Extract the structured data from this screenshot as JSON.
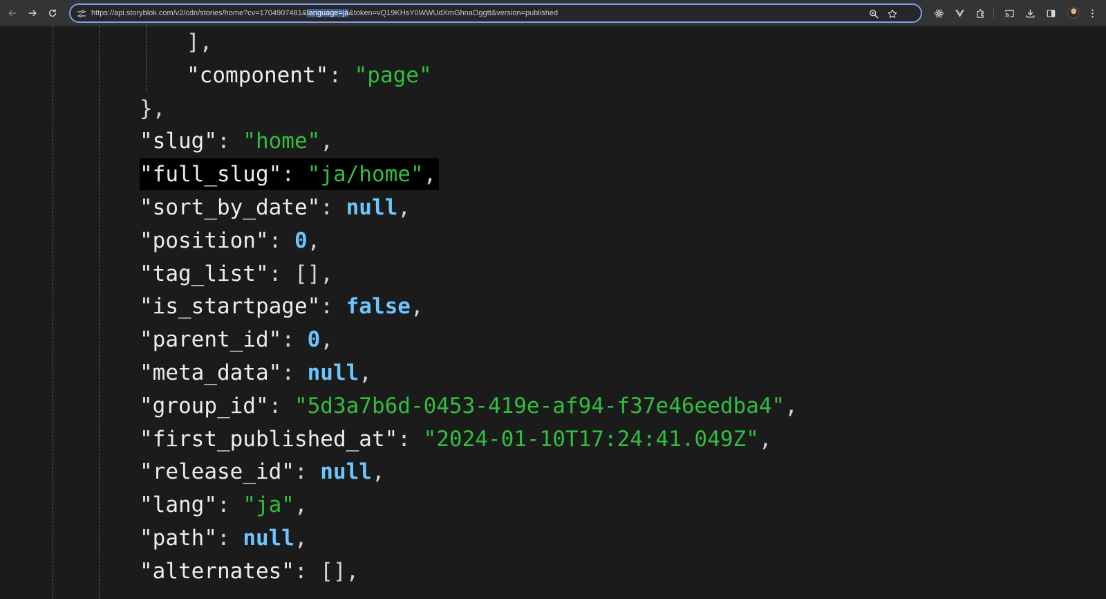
{
  "browser": {
    "url": {
      "before": "https://api.storyblok.com/v2/cdn/stories/home?cv=1704907481&",
      "selected": "language=ja",
      "after": "&token=vQ19KHsY0WWUdXmGhnaOggtt&version=published"
    },
    "toolbar_icons": [
      "back-icon",
      "forward-icon",
      "reload-icon",
      "site-settings-icon",
      "zoom-icon",
      "bookmark-star-icon",
      "react-devtools-icon",
      "vue-devtools-icon",
      "extensions-icon",
      "cast-icon",
      "downloads-icon",
      "side-panel-icon",
      "profile-avatar",
      "menu-kebab-icon"
    ]
  },
  "json_lines": [
    {
      "pre": "],",
      "key": "",
      "sep": "",
      "val": "",
      "vtype": "",
      "post": ""
    },
    {
      "pre": "",
      "key": "\"component\"",
      "sep": ": ",
      "val": "\"page\"",
      "vtype": "s",
      "post": ""
    },
    {
      "pre": "},",
      "key": "",
      "sep": "",
      "val": "",
      "vtype": "",
      "post": ""
    },
    {
      "pre": "",
      "key": "\"slug\"",
      "sep": ": ",
      "val": "\"home\"",
      "vtype": "s",
      "post": ","
    },
    {
      "pre": "",
      "key": "\"full_slug\"",
      "sep": ": ",
      "val": "\"ja/home\"",
      "vtype": "s",
      "post": ",",
      "highlighted": true
    },
    {
      "pre": "",
      "key": "\"sort_by_date\"",
      "sep": ": ",
      "val": "null",
      "vtype": "kw",
      "post": ","
    },
    {
      "pre": "",
      "key": "\"position\"",
      "sep": ": ",
      "val": "0",
      "vtype": "kw",
      "post": ","
    },
    {
      "pre": "",
      "key": "\"tag_list\"",
      "sep": ": ",
      "val": "[]",
      "vtype": "p",
      "post": ","
    },
    {
      "pre": "",
      "key": "\"is_startpage\"",
      "sep": ": ",
      "val": "false",
      "vtype": "kw",
      "post": ","
    },
    {
      "pre": "",
      "key": "\"parent_id\"",
      "sep": ": ",
      "val": "0",
      "vtype": "kw",
      "post": ","
    },
    {
      "pre": "",
      "key": "\"meta_data\"",
      "sep": ": ",
      "val": "null",
      "vtype": "kw",
      "post": ","
    },
    {
      "pre": "",
      "key": "\"group_id\"",
      "sep": ": ",
      "val": "\"5d3a7b6d-0453-419e-af94-f37e46eedba4\"",
      "vtype": "s",
      "post": ","
    },
    {
      "pre": "",
      "key": "\"first_published_at\"",
      "sep": ": ",
      "val": "\"2024-01-10T17:24:41.049Z\"",
      "vtype": "s",
      "post": ","
    },
    {
      "pre": "",
      "key": "\"release_id\"",
      "sep": ": ",
      "val": "null",
      "vtype": "kw",
      "post": ","
    },
    {
      "pre": "",
      "key": "\"lang\"",
      "sep": ": ",
      "val": "\"ja\"",
      "vtype": "s",
      "post": ","
    },
    {
      "pre": "",
      "key": "\"path\"",
      "sep": ": ",
      "val": "null",
      "vtype": "kw",
      "post": ","
    },
    {
      "pre": "",
      "key": "\"alternates\"",
      "sep": ": ",
      "val": "[]",
      "vtype": "p",
      "post": ","
    }
  ],
  "colors": {
    "string": "#2fbf3f",
    "keyword": "#6bc6ff",
    "key": "#ececec",
    "background": "#1b1b1b",
    "highlight_bg": "#000000",
    "omnibox_border": "#7ca0e6"
  }
}
